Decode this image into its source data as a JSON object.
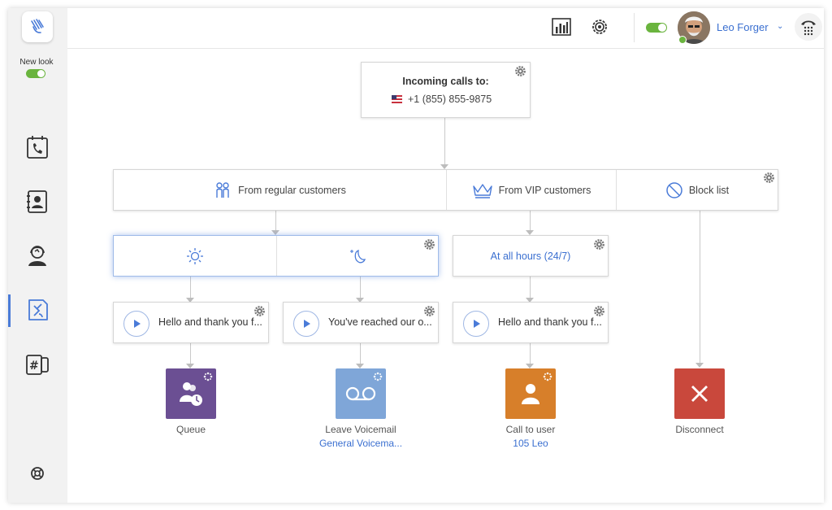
{
  "app": {
    "sidebar": {
      "new_look_label": "New look",
      "new_look_enabled": true,
      "items": [
        {
          "name": "calls",
          "icon": "phone-calendar-icon",
          "active": false
        },
        {
          "name": "contacts",
          "icon": "contact-book-icon",
          "active": false
        },
        {
          "name": "support",
          "icon": "agent-headset-icon",
          "active": false
        },
        {
          "name": "call-flows",
          "icon": "call-routing-icon",
          "active": true
        },
        {
          "name": "numbers",
          "icon": "hash-phone-icon",
          "active": false
        }
      ],
      "help_icon": "lifebuoy-icon"
    },
    "topbar": {
      "stats_icon": "bar-chart-icon",
      "settings_icon": "settings-icon",
      "availability_on": true,
      "user_name": "Leo Forger",
      "dialer_icon": "dialpad-icon"
    }
  },
  "flow": {
    "incoming": {
      "title": "Incoming calls to:",
      "number": "+1 (855) 855-9875",
      "flag_icon": "us-flag-icon"
    },
    "rules": [
      {
        "label": "From regular customers",
        "icon": "people-icon"
      },
      {
        "label": "From VIP customers",
        "icon": "crown-icon"
      },
      {
        "label": "Block list",
        "icon": "block-icon"
      }
    ],
    "schedules": {
      "regular": [
        {
          "icon": "sun-icon"
        },
        {
          "icon": "moon-icon"
        }
      ],
      "vip": {
        "label": "At all hours (24/7)"
      }
    },
    "greetings": [
      "Hello and thank you f...",
      "You've reached our o...",
      "Hello and thank you f..."
    ],
    "actions": [
      {
        "label": "Queue",
        "sub": "",
        "color": "#6b4f93",
        "icon": "queue-users-icon"
      },
      {
        "label": "Leave Voicemail",
        "sub": "General Voicema...",
        "color": "#7fa6d8",
        "icon": "voicemail-icon"
      },
      {
        "label": "Call to user",
        "sub": "105 Leo",
        "color": "#d77f2a",
        "icon": "user-icon"
      },
      {
        "label": "Disconnect",
        "sub": "",
        "color": "#c9483c",
        "icon": "close-icon"
      }
    ]
  }
}
